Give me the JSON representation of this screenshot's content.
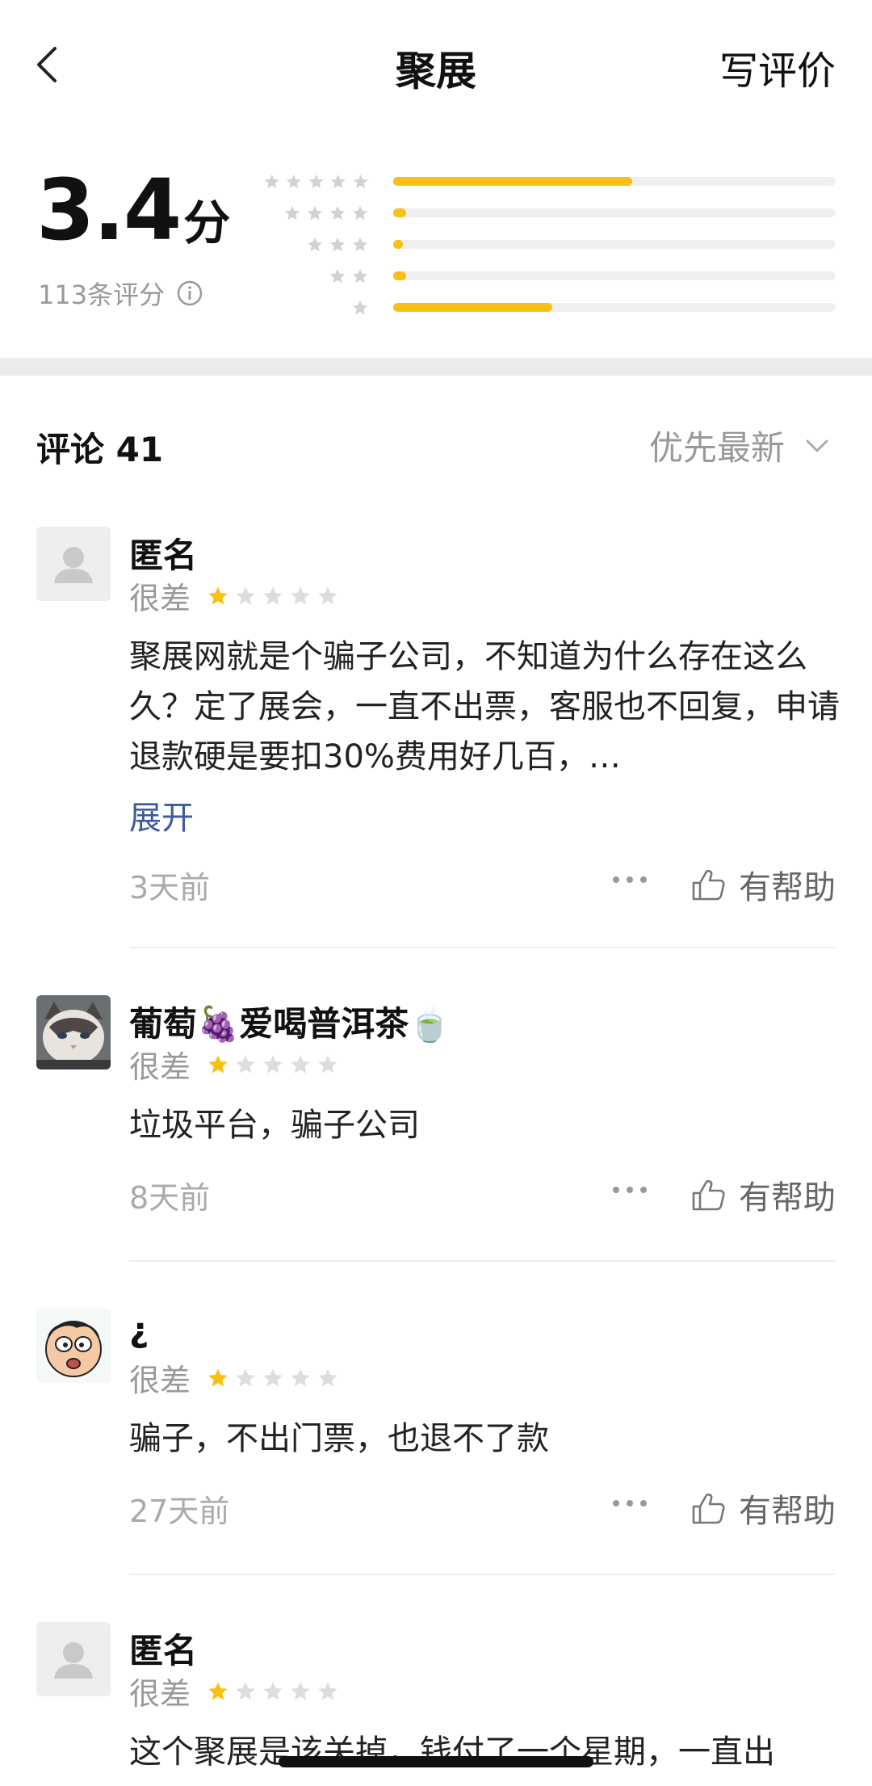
{
  "header": {
    "back_icon": "chevron-left-icon",
    "title": "聚展",
    "write_review": "写评价"
  },
  "summary": {
    "score": "3.4",
    "score_unit": "分",
    "count_text": "113条评分",
    "info_icon": "info-circle-icon",
    "distribution": [
      {
        "stars": 5,
        "fraction": 0.54
      },
      {
        "stars": 4,
        "fraction": 0.03
      },
      {
        "stars": 3,
        "fraction": 0.02
      },
      {
        "stars": 2,
        "fraction": 0.03
      },
      {
        "stars": 1,
        "fraction": 0.36
      }
    ],
    "colors": {
      "bar_fill": "#f8c012",
      "bar_track": "#efefef"
    }
  },
  "comments": {
    "title": "评论 41",
    "sort_label": "优先最新",
    "items": [
      {
        "name": "匿名",
        "rating_label": "很差",
        "stars": 1,
        "text": "聚展网就是个骗子公司，不知道为什么存在这么久？定了展会，一直不出票，客服也不回复，申请退款硬是要扣30%费用好几百，…",
        "expand": "展开",
        "time": "3天前",
        "helpful": "有帮助"
      },
      {
        "name": "葡萄🍇爱喝普洱茶🍵",
        "rating_label": "很差",
        "stars": 1,
        "text": "垃圾平台，骗子公司",
        "time": "8天前",
        "helpful": "有帮助"
      },
      {
        "name": "¿",
        "rating_label": "很差",
        "stars": 1,
        "text": "骗子，不出门票，也退不了款",
        "time": "27天前",
        "helpful": "有帮助"
      },
      {
        "name": "匿名",
        "rating_label": "很差",
        "stars": 1,
        "text": "这个聚展是该关掉，钱付了一个星期，一直出"
      }
    ]
  },
  "colors": {
    "star_active": "#f8c012",
    "star_inactive": "#dddddd",
    "link": "#3d5a9a"
  }
}
